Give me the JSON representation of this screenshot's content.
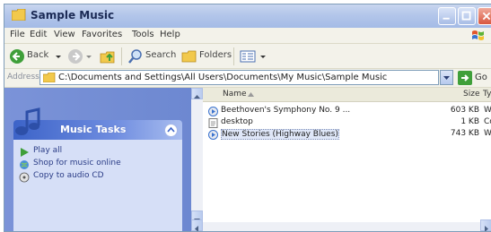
{
  "window": {
    "title": "Sample Music"
  },
  "menu": [
    "File",
    "Edit",
    "View",
    "Favorites",
    "Tools",
    "Help"
  ],
  "toolbar": {
    "back_label": "Back",
    "search_label": "Search",
    "folders_label": "Folders"
  },
  "address": {
    "label": "Address",
    "value": "C:\\Documents and Settings\\All Users\\Documents\\My Music\\Sample Music",
    "go_label": "Go"
  },
  "tasks": {
    "title": "Music Tasks",
    "items": [
      {
        "label": "Play all",
        "icon": "play-icon"
      },
      {
        "label": "Shop for music online",
        "icon": "globe-icon"
      },
      {
        "label": "Copy to audio CD",
        "icon": "cd-icon"
      }
    ]
  },
  "columns": {
    "name": "Name",
    "size": "Size",
    "type": "Type"
  },
  "files": [
    {
      "name": "Beethoven's Symphony No. 9 ...",
      "size": "603 KB",
      "type": "Wind",
      "icon": "media-file-icon",
      "selected": false
    },
    {
      "name": "desktop",
      "size": "1 KB",
      "type": "Conf",
      "icon": "settings-file-icon",
      "selected": false
    },
    {
      "name": "New Stories (Highway Blues)",
      "size": "743 KB",
      "type": "Wind",
      "icon": "media-file-icon",
      "selected": true
    }
  ],
  "colors": {
    "titlebar": "#b3c6ea",
    "task_pane": "#6d88d1",
    "task_body": "#d6dff7",
    "selection": "#dfe7f8"
  }
}
